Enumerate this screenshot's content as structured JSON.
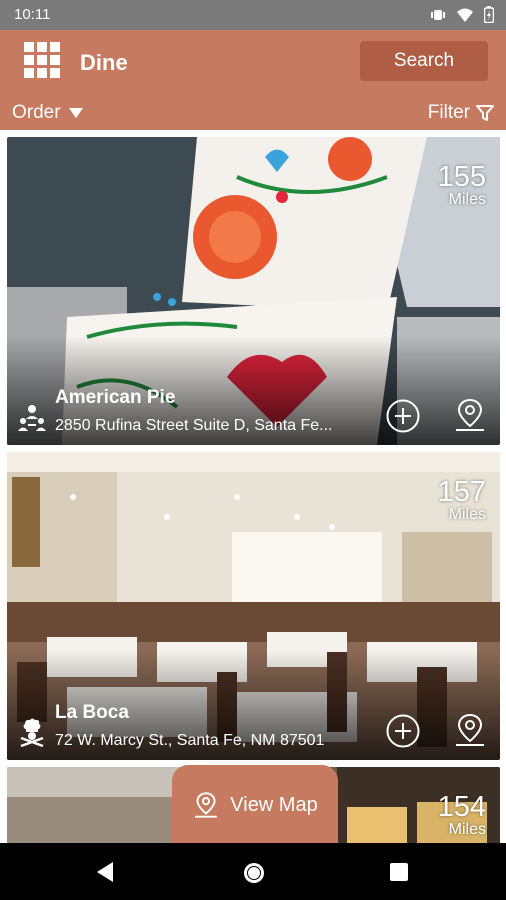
{
  "status_bar": {
    "time": "10:11"
  },
  "app_bar": {
    "title": "Dine",
    "search_label": "Search"
  },
  "filter_bar": {
    "order_label": "Order",
    "filter_label": "Filter"
  },
  "listings": [
    {
      "name": "American Pie",
      "address": "2850 Rufina Street Suite D, Santa Fe...",
      "distance": "155",
      "unit": "Miles",
      "category_icon": "family-icon"
    },
    {
      "name": "La Boca",
      "address": "72 W. Marcy St., Santa Fe, NM 87501",
      "distance": "157",
      "unit": "Miles",
      "category_icon": "chef-icon"
    },
    {
      "distance": "154",
      "unit": "Miles"
    }
  ],
  "view_map": {
    "label": "View Map"
  },
  "colors": {
    "accent": "#c67a5f",
    "accent_dark": "#b05d45",
    "status_bar": "#7a7a7a"
  }
}
